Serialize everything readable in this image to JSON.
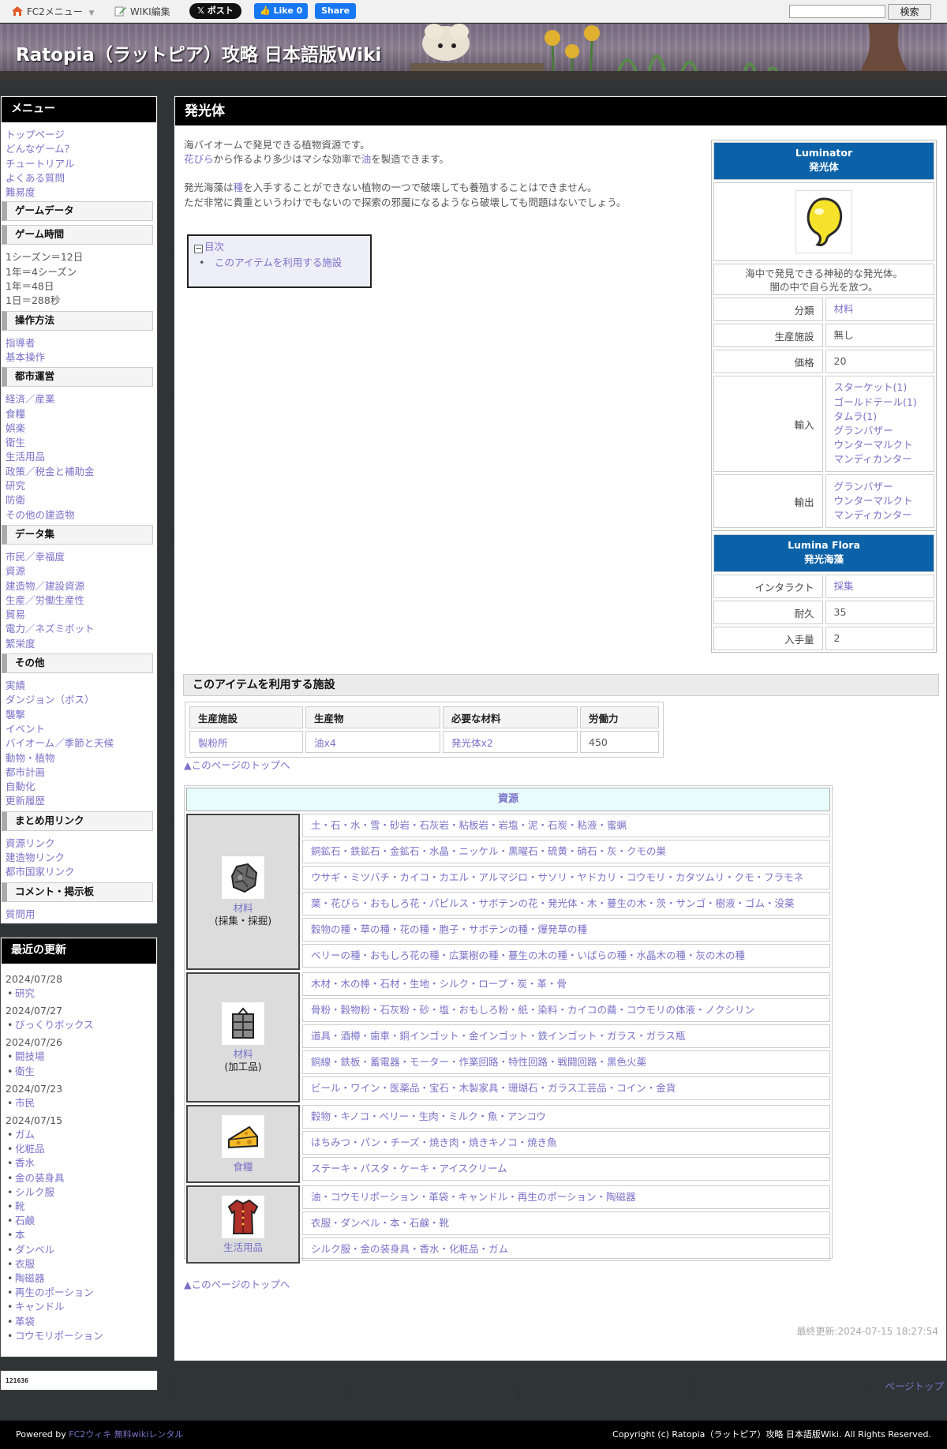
{
  "topbar": {
    "fc2menu": "FC2メニュー",
    "wiki_edit": "WIKI編集",
    "x_post": "𝕏 ポスト",
    "fb_like": "Like 0",
    "fb_share": "Share",
    "search_value": "",
    "search_button": "検索"
  },
  "header": {
    "site_title": "Ratopia（ラットピア）攻略 日本語版Wiki"
  },
  "sidebar": {
    "menu_title": "メニュー",
    "top_links": [
      "トップページ",
      "どんなゲーム？",
      "チュートリアル",
      "よくある質問",
      "難易度"
    ],
    "h_gamedata": "ゲームデータ",
    "h_gametime": "ゲーム時間",
    "gametime_lines": [
      "1シーズン＝12日",
      "1年＝4シーズン",
      "1年＝48日",
      "1日＝288秒"
    ],
    "h_controls": "操作方法",
    "controls_links": [
      "指導者",
      "基本操作"
    ],
    "h_city": "都市運営",
    "city_links": [
      "経済／産業",
      "食糧",
      "娯楽",
      "衛生",
      "生活用品",
      "政策／税金と補助金",
      "研究",
      "防衛",
      "その他の建造物"
    ],
    "h_data": "データ集",
    "data_links": [
      "市民／幸福度",
      "資源",
      "建造物／建設資源",
      "生産／労働生産性",
      "貿易",
      "電力／ネズミボット",
      "繁栄度"
    ],
    "h_other": "その他",
    "other_links": [
      "実績",
      "ダンジョン（ボス）",
      "襲撃",
      "イベント",
      "バイオーム／季節と天候",
      "動物・植物",
      "都市計画",
      "自動化",
      "更新履歴"
    ],
    "h_links": "まとめ用リンク",
    "links_links": [
      "資源リンク",
      "建造物リンク",
      "都市国家リンク"
    ],
    "h_comments": "コメント・掲示板",
    "comments_links": [
      "質問用"
    ]
  },
  "recent": {
    "title": "最近の更新",
    "groups": [
      {
        "date": "2024/07/28",
        "items": [
          "研究"
        ]
      },
      {
        "date": "2024/07/27",
        "items": [
          "びっくりボックス"
        ]
      },
      {
        "date": "2024/07/26",
        "items": [
          "闘技場",
          "衛生"
        ]
      },
      {
        "date": "2024/07/23",
        "items": [
          "市民"
        ]
      },
      {
        "date": "2024/07/15",
        "items": [
          "ガム",
          "化粧品",
          "香水",
          "金の装身具",
          "シルク服",
          "靴",
          "石鹸",
          "本",
          "ダンベル",
          "衣服",
          "陶磁器",
          "再生のポーション",
          "キャンドル",
          "革袋",
          "コウモリポーション"
        ]
      }
    ],
    "counter": "121636"
  },
  "main": {
    "page_title": "発光体",
    "intro": {
      "l1": "海バイオームで発見できる植物資源です。",
      "l2_link1": "花びら",
      "l2_mid": "から作るより多少はマシな効率で",
      "l2_link2": "油",
      "l2_end": "を製造できます。",
      "l3_pre": "発光海藻は",
      "l3_link": "種",
      "l3_end": "を入手することができない植物の一つで破壊しても養殖することはできません。",
      "l4": "ただ非常に貴重というわけでもないので探索の邪魔になるようなら破壊しても問題はないでしょう。"
    },
    "toc": {
      "label": "目次",
      "items": [
        "このアイテムを利用する施設"
      ]
    },
    "infobox": {
      "title_en": "Luminator",
      "title_ja": "発光体",
      "desc1": "海中で発見できる神秘的な発光体。",
      "desc2": "闇の中で自ら光を放つ。",
      "k_category": "分類",
      "v_category": "材料",
      "k_facility": "生産施設",
      "v_facility": "無し",
      "k_price": "価格",
      "v_price": "20",
      "k_import": "輸入",
      "v_import": [
        "スターケット(1)",
        "ゴールドテール(1)",
        "タムラ(1)",
        "グランバザー",
        "ウンターマルクト",
        "マンディカンター"
      ],
      "k_export": "輸出",
      "v_export": [
        "グランバザー",
        "ウンターマルクト",
        "マンディカンター"
      ],
      "title2_en": "Lumina Flora",
      "title2_ja": "発光海藻",
      "k_interact": "インタラクト",
      "v_interact": "採集",
      "k_durability": "耐久",
      "v_durability": "35",
      "k_yield": "入手量",
      "v_yield": "2"
    },
    "section_title": "このアイテムを利用する施設",
    "facility_table": {
      "headers": [
        "生産施設",
        "生産物",
        "必要な材料",
        "労働力"
      ],
      "row": [
        "製粉所",
        "油x4",
        "発光体x2",
        "450"
      ]
    },
    "toplink": "▲このページのトップへ",
    "resources": {
      "title": "資源",
      "groups": [
        {
          "cat": "材料",
          "sub": "(採集・採掘)",
          "icon": "ore-icon",
          "rows": [
            "土・石・水・雪・砂岩・石灰岩・粘板岩・岩塩・泥・石炭・粘液・蜜蝋",
            "銅鉱石・鉄鉱石・金鉱石・水晶・ニッケル・黒曜石・硫黄・硝石・灰・クモの巣",
            "ウサギ・ミツバチ・カイコ・カエル・アルマジロ・サソリ・ヤドカリ・コウモリ・カタツムリ・クモ・フラモネ",
            "葉・花びら・おもしろ花・パピルス・サボテンの花・発光体・木・蔓生の木・茨・サンゴ・樹液・ゴム・没薬",
            "穀物の種・草の種・花の種・胞子・サボテンの種・爆発草の種",
            "ベリーの種・おもしろ花の種・広葉樹の種・蔓生の木の種・いばらの種・水晶木の種・灰の木の種"
          ]
        },
        {
          "cat": "材料",
          "sub": "(加工品)",
          "icon": "crate-icon",
          "rows": [
            "木材・木の棒・石材・生地・シルク・ロープ・炭・革・骨",
            "骨粉・穀物粉・石灰粉・砂・塩・おもしろ粉・紙・染料・カイコの繭・コウモリの体液・ノクシリン",
            "道具・酒樽・歯車・銅インゴット・金インゴット・鉄インゴット・ガラス・ガラス瓶",
            "銅線・鉄板・蓄電器・モーター・作業回路・特性回路・戦闘回路・黒色火薬",
            "ビール・ワイン・医薬品・宝石・木製家具・珊瑚石・ガラス工芸品・コイン・金貨"
          ]
        },
        {
          "cat": "食糧",
          "sub": "",
          "icon": "cheese-icon",
          "rows": [
            "穀物・キノコ・ベリー・生肉・ミルク・魚・アンコウ",
            "はちみつ・パン・チーズ・焼き肉・焼きキノコ・焼き魚",
            "ステーキ・パスタ・ケーキ・アイスクリーム"
          ]
        },
        {
          "cat": "生活用品",
          "sub": "",
          "icon": "clothes-icon",
          "rows": [
            "油・コウモリポーション・革袋・キャンドル・再生のポーション・陶磁器",
            "衣服・ダンベル・本・石鹸・靴",
            "シルク服・金の装身具・香水・化粧品・ガム"
          ]
        }
      ]
    },
    "last_modified": "最終更新:2024-07-15 18:27:54"
  },
  "footer": {
    "pagetop": "ページトップ",
    "powered_prefix": "Powered by ",
    "powered_link": "FC2ウィキ 無料wikiレンタル",
    "copyright": "Copyright (c) Ratopia（ラットピア）攻略 日本語版Wiki. All Rights Reserved."
  }
}
